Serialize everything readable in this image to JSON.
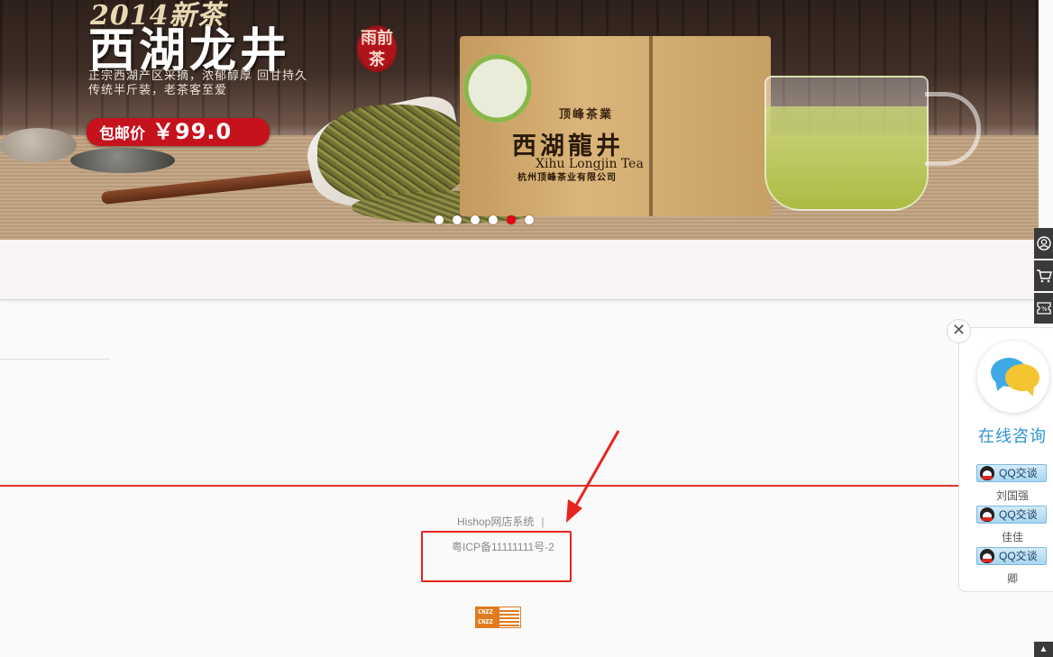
{
  "banner": {
    "year_text": "2014新茶",
    "headline": "西湖龙井",
    "seal": "雨前茶",
    "tagline_1": "正宗西湖产区采摘，浓郁醇厚 回甘持久",
    "tagline_2": "传统半斤装，老茶客至爱",
    "price_label": "包邮价",
    "price_value": "￥99.0",
    "package": {
      "brand": "顶峰茶業",
      "name_cn": "西湖龍井",
      "name_en": "Xihu Longjin Tea",
      "company": "杭州顶峰茶业有限公司"
    },
    "slides_count": 6,
    "active_slide": 5
  },
  "footer": {
    "brand_text": "Hishop网店系统",
    "separator": "|",
    "icp_text": "粤ICP备11111111号-2",
    "stat_badge": "CNZZ"
  },
  "annotation": {
    "highlight_color": "#e8241c"
  },
  "right_toolbar": {
    "items": [
      {
        "icon": "user-icon"
      },
      {
        "icon": "cart-icon"
      },
      {
        "icon": "coupon-icon"
      }
    ],
    "bottom_icon": "back-to-top-icon"
  },
  "chat": {
    "close_symbol": "✕",
    "title": "在线咨询",
    "contacts": [
      {
        "button_label": "QQ交谈",
        "name": "刘国强"
      },
      {
        "button_label": "QQ交谈",
        "name": "佳佳"
      },
      {
        "button_label": "QQ交谈",
        "name": "卿"
      }
    ]
  },
  "colors": {
    "accent_red": "#e8342b",
    "chat_blue": "#2f93d3",
    "toolbar_dark": "#3a3a3a"
  }
}
